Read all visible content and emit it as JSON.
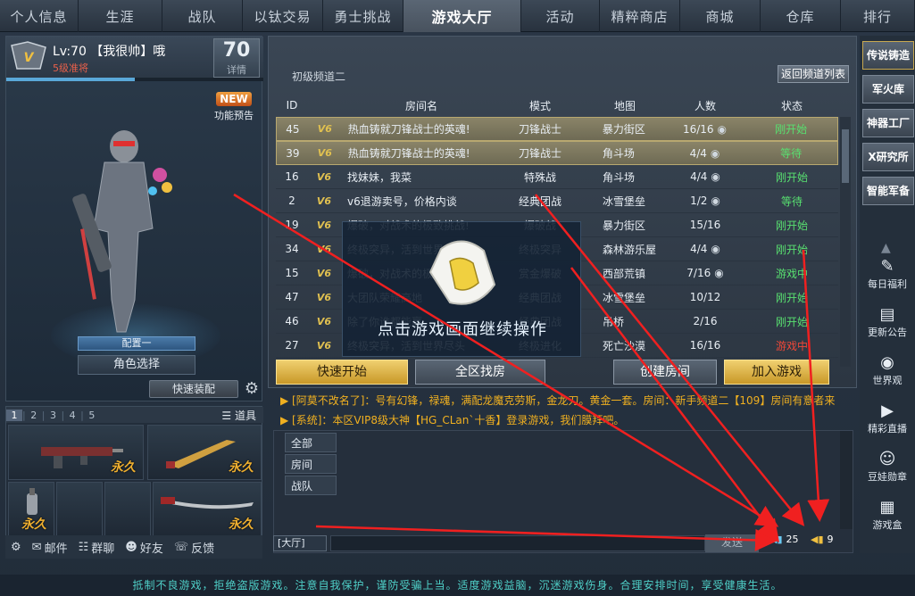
{
  "topnav": [
    {
      "label": "个人信息",
      "w": 88
    },
    {
      "label": "生涯",
      "w": 94
    },
    {
      "label": "战队",
      "w": 90
    },
    {
      "label": "以钛交易",
      "w": 90
    },
    {
      "label": "勇士挑战",
      "w": 90
    },
    {
      "label": "游戏大厅",
      "w": 132,
      "active": true
    },
    {
      "label": "活动",
      "w": 88
    },
    {
      "label": "精粹商店",
      "w": 90
    },
    {
      "label": "商城",
      "w": 90
    },
    {
      "label": "仓库",
      "w": 90
    },
    {
      "label": "排行",
      "w": 83
    }
  ],
  "profile": {
    "level": "Lv:70 【我很帅】哦",
    "rank": "5级准将",
    "lv_num": "70",
    "lv_detail": "详情",
    "xp": 0.5
  },
  "new_badge": {
    "tag": "NEW",
    "label": "功能预告"
  },
  "config_btn": "配置一",
  "role_select": "角色选择",
  "quick_equip": "快速装配",
  "inventory": {
    "tabs": [
      "1",
      "2",
      "3",
      "4",
      "5"
    ],
    "props_label": "道具",
    "items": [
      "永久",
      "永久",
      "永久",
      "永久"
    ]
  },
  "left_bottom": [
    {
      "icon": "mail-icon",
      "label": "邮件"
    },
    {
      "icon": "group-chat-icon",
      "label": "群聊"
    },
    {
      "icon": "friends-icon",
      "label": "好友"
    },
    {
      "icon": "feedback-icon",
      "label": "反馈"
    }
  ],
  "channel": {
    "name": "初级频道二",
    "back": "返回频道列表"
  },
  "table": {
    "headers": [
      "ID",
      "房间名",
      "模式",
      "地图",
      "人数",
      "状态"
    ],
    "rows": [
      {
        "id": "45",
        "rank": "V6",
        "name": "热血铸就刀锋战士的英魂!",
        "mode": "刀锋战士",
        "map": "暴力街区",
        "count": "16/16",
        "eye": true,
        "status": "刚开始",
        "status_color": "green",
        "hl": true
      },
      {
        "id": "39",
        "rank": "V6",
        "name": "热血铸就刀锋战士的英魂!",
        "mode": "刀锋战士",
        "map": "角斗场",
        "count": "4/4",
        "eye": true,
        "status": "等待",
        "status_color": "green",
        "hl": true
      },
      {
        "id": "16",
        "rank": "V6",
        "name": "找妹妹，我菜",
        "mode": "特殊战",
        "map": "角斗场",
        "count": "4/4",
        "eye": true,
        "status": "刚开始",
        "status_color": "green"
      },
      {
        "id": "2",
        "rank": "V6",
        "name": "v6退游卖号，价格内谈",
        "mode": "经典团战",
        "map": "冰雪堡垒",
        "count": "1/2",
        "eye": true,
        "status": "等待",
        "status_color": "green"
      },
      {
        "id": "19",
        "rank": "V6",
        "name": "爆破，对战术的极致挑战!",
        "mode": "爆破战",
        "map": "暴力街区",
        "count": "15/16",
        "eye": false,
        "status": "刚开始",
        "status_color": "green"
      },
      {
        "id": "34",
        "rank": "V6",
        "name": "终极突异，活到世界尽头",
        "mode": "终极突异",
        "map": "森林游乐屋",
        "count": "4/4",
        "eye": true,
        "status": "刚开始",
        "status_color": "green"
      },
      {
        "id": "15",
        "rank": "V6",
        "name": "爆破，对战术的极致挑战!",
        "mode": "赏金爆破",
        "map": "西部荒镇",
        "count": "7/16",
        "eye": true,
        "status": "游戏中",
        "status_color": "green"
      },
      {
        "id": "47",
        "rank": "V6",
        "name": "大团队荣耀高地",
        "mode": "经典团战",
        "map": "冰雪堡垒",
        "count": "10/12",
        "eye": false,
        "status": "刚开始",
        "status_color": "green"
      },
      {
        "id": "46",
        "rank": "V6",
        "name": "除了你谁都能赢",
        "mode": "经典团战",
        "map": "吊桥",
        "count": "2/16",
        "eye": false,
        "status": "刚开始",
        "status_color": "green"
      },
      {
        "id": "27",
        "rank": "V6",
        "name": "终极突异，活到世界尽头",
        "mode": "终极进化",
        "map": "死亡沙漠",
        "count": "16/16",
        "eye": false,
        "status": "游戏中",
        "status_color": "red"
      }
    ]
  },
  "actions": {
    "quick": "快速开始",
    "find": "全区找房",
    "create": "创建房间",
    "join": "加入游戏"
  },
  "overlay": {
    "text": "点击游戏画面继续操作"
  },
  "chat": {
    "messages": [
      "[阿莫不改名了]：号有幻锋，禄魂，满配龙魔克劳斯，金龙刀。黄金一套。房间：新手频道二【109】房间有意者来",
      "[系统]：本区VIP8级大神【HG_CLan`十香】登录游戏，我们膜拜吧。"
    ],
    "tabs": [
      "全部",
      "房间",
      "战队"
    ],
    "channel": "[大厅]",
    "send": "发送",
    "vol1": "25",
    "vol2": "9"
  },
  "right_buttons": [
    "传说铸造",
    "军火库",
    "神器工厂",
    "X研究所",
    "智能军备"
  ],
  "right_items": [
    {
      "icon": "daily-welfare-icon",
      "glyph": "✎",
      "label": "每日福利"
    },
    {
      "icon": "announcement-icon",
      "glyph": "▤",
      "label": "更新公告"
    },
    {
      "icon": "world-view-icon",
      "glyph": "◉",
      "label": "世界观"
    },
    {
      "icon": "live-stream-icon",
      "glyph": "▶",
      "label": "精彩直播"
    },
    {
      "icon": "doudou-badge-icon",
      "glyph": "☺",
      "label": "豆娃勋章"
    },
    {
      "icon": "game-box-icon",
      "glyph": "▦",
      "label": "游戏盒"
    }
  ],
  "footer": "抵制不良游戏，拒绝盗版游戏。注意自我保护，谨防受骗上当。适度游戏益脑，沉迷游戏伤身。合理安排时间，享受健康生活。"
}
